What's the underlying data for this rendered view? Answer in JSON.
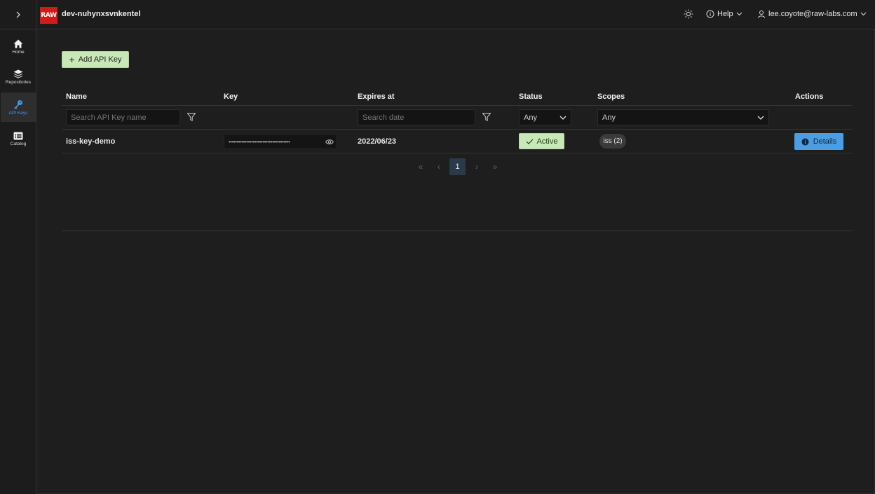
{
  "app": {
    "workspace_name": "dev-nuhynxsvnkentel",
    "logo_text": "RAW",
    "help_label": "Help",
    "user_email": "lee.coyote@raw-labs.com"
  },
  "sidebar": {
    "items": [
      {
        "label": "Home",
        "icon": "home-icon"
      },
      {
        "label": "Repositories",
        "icon": "layers-icon"
      },
      {
        "label": "API Keys",
        "icon": "key-icon",
        "active": true
      },
      {
        "label": "Catalog",
        "icon": "list-icon"
      }
    ]
  },
  "toolbar": {
    "add_label": "Add API Key"
  },
  "table": {
    "columns": [
      "Name",
      "Key",
      "Expires at",
      "Status",
      "Scopes",
      "Actions"
    ],
    "filters": {
      "name_placeholder": "Search API Key name",
      "date_placeholder": "Search date",
      "status_value": "Any",
      "scopes_value": "Any"
    },
    "rows": [
      {
        "name": "iss-key-demo",
        "key_masked": "••••••••••••••••••••••••••••••••••••••",
        "expires": "2022/06/23",
        "status": "Active",
        "scope": "iss (2)",
        "action": "Details"
      }
    ]
  },
  "pagination": {
    "current_page": "1",
    "first": "«",
    "prev": "‹",
    "next": "›",
    "last": "»"
  },
  "colors": {
    "accent_blue": "#4a9fe4",
    "success_green": "#c9e8b8",
    "logo_red": "#d11a1a"
  }
}
